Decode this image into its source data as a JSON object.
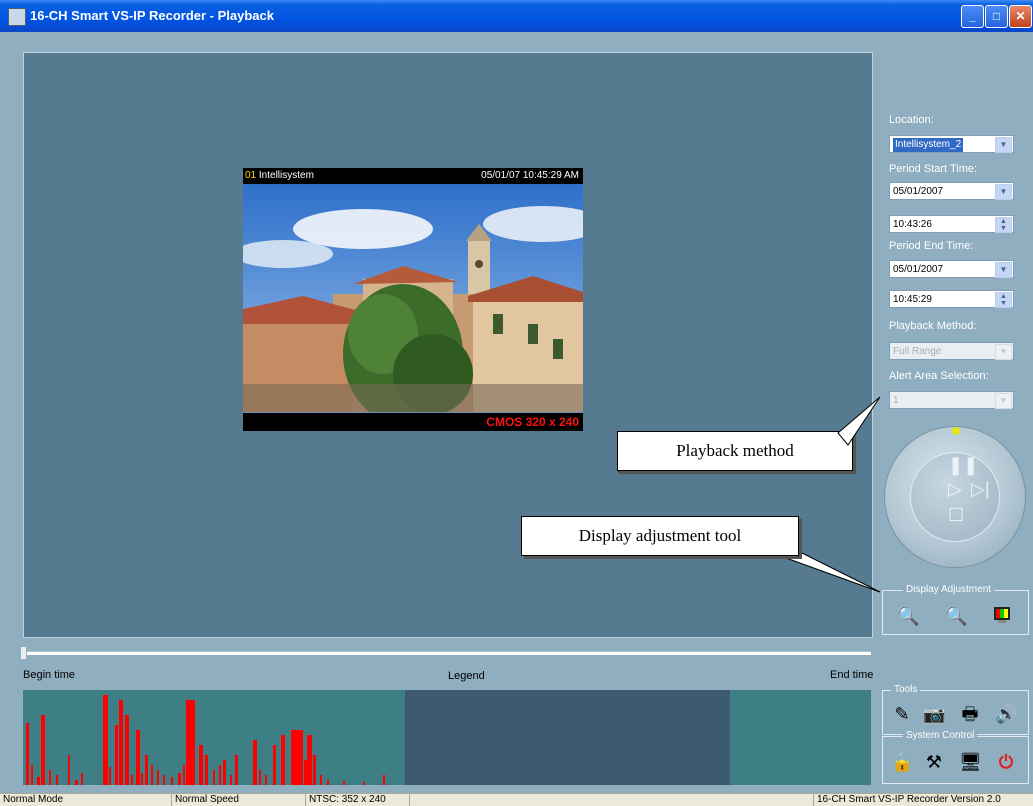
{
  "window": {
    "title": "16-CH Smart VS-IP Recorder - Playback",
    "buttons": {
      "minimize": "_",
      "maximize": "□",
      "close": "✕"
    }
  },
  "video": {
    "channel": "01",
    "camera_name": "Intellisystem",
    "timestamp": "05/01/07 10:45:29 AM",
    "resolution_label": "CMOS 320 x 240"
  },
  "panel": {
    "location_label": "Location:",
    "location_value": "Intellisystem_2",
    "start_label": "Period Start Time:",
    "start_date": "05/01/2007",
    "start_time": "10:43:26",
    "end_label": "Period End Time:",
    "end_date": "05/01/2007",
    "end_time": "10:45:29",
    "method_label": "Playback Method:",
    "method_value": "Full Range",
    "alert_label": "Alert Area Selection:",
    "alert_value": "1"
  },
  "groups": {
    "display": "Display Adjustment",
    "tools": "Tools",
    "system": "System Control"
  },
  "timeline": {
    "begin": "Begin time",
    "legend": "Legend",
    "end": "End time"
  },
  "callouts": {
    "playback": "Playback method",
    "display": "Display adjustment tool"
  },
  "status": {
    "mode": "Normal Mode",
    "speed": "Normal Speed",
    "format": "NTSC: 352 x 240",
    "product": "16-CH Smart VS-IP Recorder   Version 2.0"
  },
  "colors": {
    "event": "#FF0000",
    "recorded": "#3E7F86",
    "no_record": "#3D5A6E",
    "viewer_bg": "#567A8F"
  }
}
